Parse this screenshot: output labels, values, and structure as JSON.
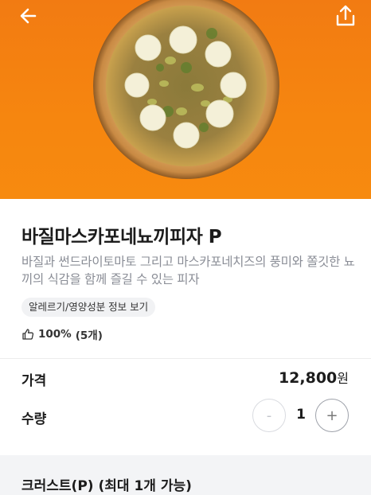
{
  "header": {
    "back_icon": "back-arrow-icon",
    "share_icon": "share-icon",
    "background_color": "#f5820f"
  },
  "product": {
    "name": "바질마스카포네뇨끼피자 P",
    "description": "바질과 썬드라이토마토 그리고 마스카포네치즈의 풍미와 쫄깃한 뇨끼의 식감을 함께 즐길 수 있는 피자",
    "allergy_chip": "알레르기/영양성분 정보 보기",
    "like": {
      "icon": "thumbs-up-icon",
      "percent": "100%",
      "count": "(5개)"
    }
  },
  "price": {
    "label": "가격",
    "amount": "12,800",
    "unit": "원"
  },
  "quantity": {
    "label": "수량",
    "value": "1",
    "minus_symbol": "-",
    "plus_symbol": "+"
  },
  "options": {
    "title": "크러스트(P) (최대 1개 가능)"
  }
}
